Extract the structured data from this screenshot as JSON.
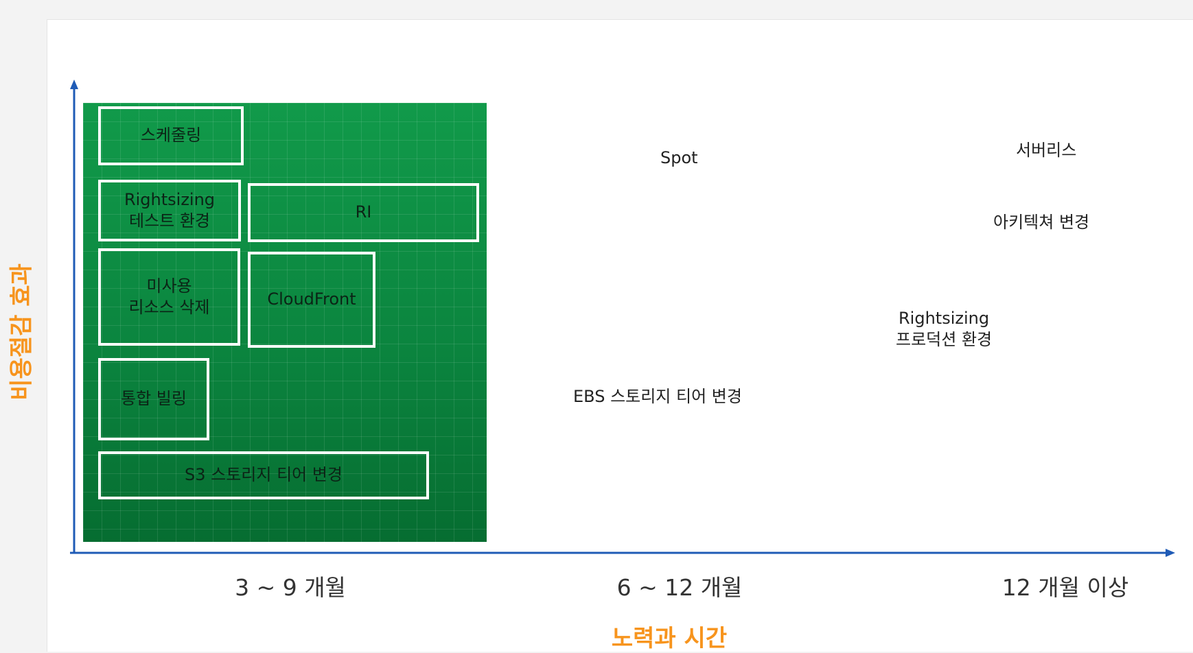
{
  "diagram": {
    "green_zone_items": [
      {
        "id": "scheduling",
        "lines": [
          "스케줄링"
        ]
      },
      {
        "id": "rightsizing-test",
        "lines": [
          "Rightsizing",
          "테스트 환경"
        ]
      },
      {
        "id": "ri",
        "lines": [
          "RI"
        ]
      },
      {
        "id": "unused-resources",
        "lines": [
          "미사용",
          "리소스 삭제"
        ]
      },
      {
        "id": "cloudfront",
        "lines": [
          "CloudFront"
        ]
      },
      {
        "id": "consolidated-billing",
        "lines": [
          "통합 빌링"
        ]
      },
      {
        "id": "s3-tier",
        "lines": [
          "S3 스토리지 티어 변경"
        ]
      }
    ],
    "other_items": [
      {
        "id": "spot",
        "lines": [
          "Spot"
        ]
      },
      {
        "id": "serverless",
        "lines": [
          "서버리스"
        ]
      },
      {
        "id": "architecture-change",
        "lines": [
          "아키텍쳐 변경"
        ]
      },
      {
        "id": "rightsizing-production",
        "lines": [
          "Rightsizing",
          "프로덕션 환경"
        ]
      },
      {
        "id": "ebs-tier",
        "lines": [
          "EBS 스토리지 티어 변경"
        ]
      }
    ],
    "x_ticks": [
      "3 ~ 9 개월",
      "6 ~ 12 개월",
      "12 개월 이상"
    ],
    "x_axis_title": "노력과 시간",
    "y_axis_title": "비용절감 효과",
    "colors": {
      "axis": "#1f5bb6",
      "axis_title": "#f7941d",
      "green_zone": "#0a8a3e",
      "box_border": "#ffffff"
    }
  }
}
